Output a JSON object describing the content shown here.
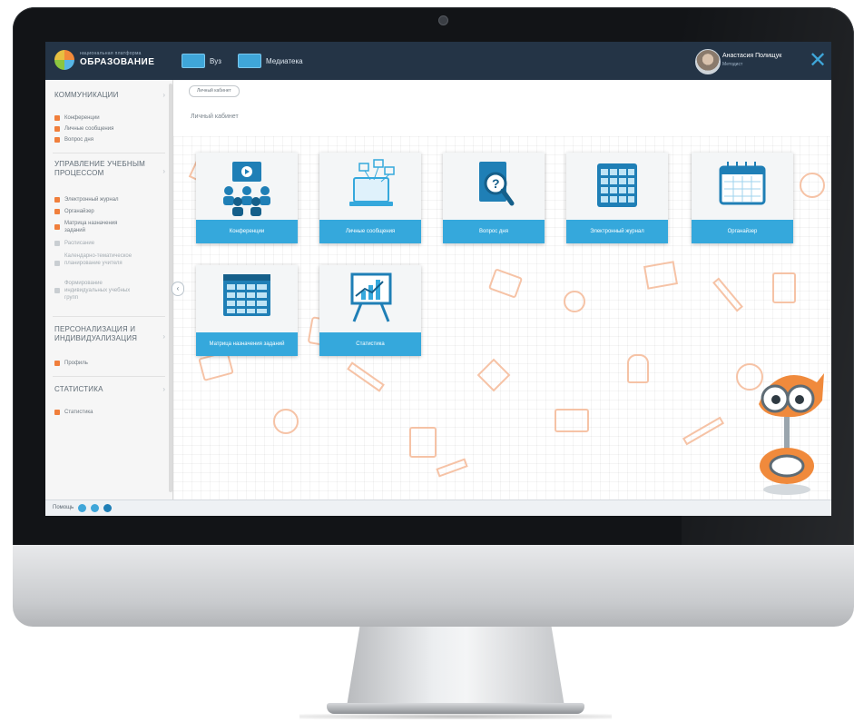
{
  "header": {
    "logo_small": "национальная платформа",
    "logo_title": "ОБРАЗОВАНИЕ",
    "links": [
      {
        "label": "Вуз",
        "icon": "blackboard-icon"
      },
      {
        "label": "Медиатека",
        "icon": "media-icon"
      }
    ],
    "user_name": "Анастасия  Полищук",
    "user_role": "Методист",
    "close_icon": "close-icon"
  },
  "sidebar": {
    "sections": [
      {
        "title": "КОММУНИКАЦИИ",
        "items": [
          {
            "label": "Конференции",
            "color": "#f07f3c"
          },
          {
            "label": "Личные сообщения",
            "color": "#f07f3c"
          },
          {
            "label": "Вопрос дня",
            "color": "#f07f3c"
          }
        ]
      },
      {
        "title": "УПРАВЛЕНИЕ УЧЕБНЫМ ПРОЦЕССОМ",
        "items": [
          {
            "label": "Электронный журнал",
            "color": "#f07f3c"
          },
          {
            "label": "Органайзер",
            "color": "#f07f3c"
          },
          {
            "label": "Матрица назначения заданий",
            "color": "#f07f3c"
          },
          {
            "label": "Расписание",
            "color": "#c9ced2"
          },
          {
            "label": "Календарно-тематическое планирование учителя",
            "color": "#c9ced2"
          },
          {
            "label": "Формирование индивидуальных учебных групп",
            "color": "#c9ced2"
          }
        ]
      },
      {
        "title": "ПЕРСОНАЛИЗАЦИЯ И ИНДИВИДУАЛИЗАЦИЯ",
        "items": [
          {
            "label": "Профиль",
            "color": "#f07f3c"
          }
        ]
      },
      {
        "title": "СТАТИСТИКА",
        "items": [
          {
            "label": "Статистика",
            "color": "#f07f3c"
          }
        ]
      }
    ]
  },
  "footer": {
    "help_label": "Помощь"
  },
  "main": {
    "breadcrumb": "Личный кабинет",
    "title": "Личный кабинет",
    "tiles": [
      {
        "label": "Конференции",
        "icon": "conference-icon"
      },
      {
        "label": "Личные сообщения",
        "icon": "messages-icon"
      },
      {
        "label": "Вопрос дня",
        "icon": "question-book-icon"
      },
      {
        "label": "Электронный журнал",
        "icon": "gradebook-icon"
      },
      {
        "label": "Органайзер",
        "icon": "calendar-icon"
      },
      {
        "label": "Матрица назначения заданий",
        "icon": "matrix-icon"
      },
      {
        "label": "Статистика",
        "icon": "statistics-icon"
      }
    ],
    "accent_color": "#35a8dc"
  }
}
